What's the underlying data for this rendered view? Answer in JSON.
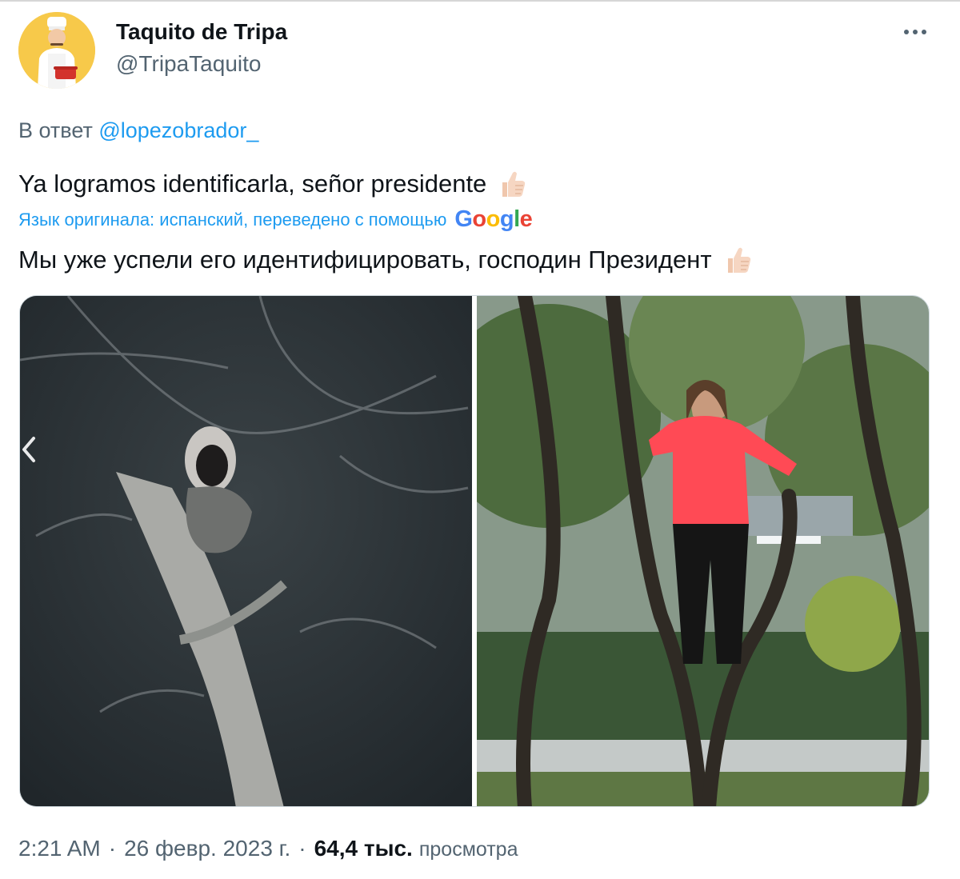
{
  "author": {
    "name": "Taquito de Tripa",
    "handle": "@TripaTaquito",
    "avatar_icon": "cook-avatar-icon"
  },
  "more_menu": {
    "icon": "more-dots-icon"
  },
  "reply": {
    "prefix": "В ответ",
    "mention": "@lopezobrador_"
  },
  "tweet": {
    "text": "Ya logramos identificarla, señor presidente",
    "emoji": "thumbs-up-icon"
  },
  "translation": {
    "note": "Язык оригинала: испанский, переведено с помощью",
    "provider": "Google",
    "text": "Мы уже успели его идентифицировать, господин Президент"
  },
  "media": {
    "left_photo": "night-tree-figure-photo",
    "right_photo": "woman-in-red-jacket-in-tree-photo",
    "prev_icon": "chevron-left-icon",
    "next_icon": "chevron-right-icon"
  },
  "meta": {
    "time": "2:21 AM",
    "separator": "·",
    "date": "26 февр. 2023 г.",
    "views_count": "64,4 тыс.",
    "views_label": "просмотра"
  },
  "colors": {
    "link": "#1d9bf0",
    "secondary_text": "#536471",
    "primary_text": "#0f1419",
    "avatar_bg": "#f7c94a"
  }
}
